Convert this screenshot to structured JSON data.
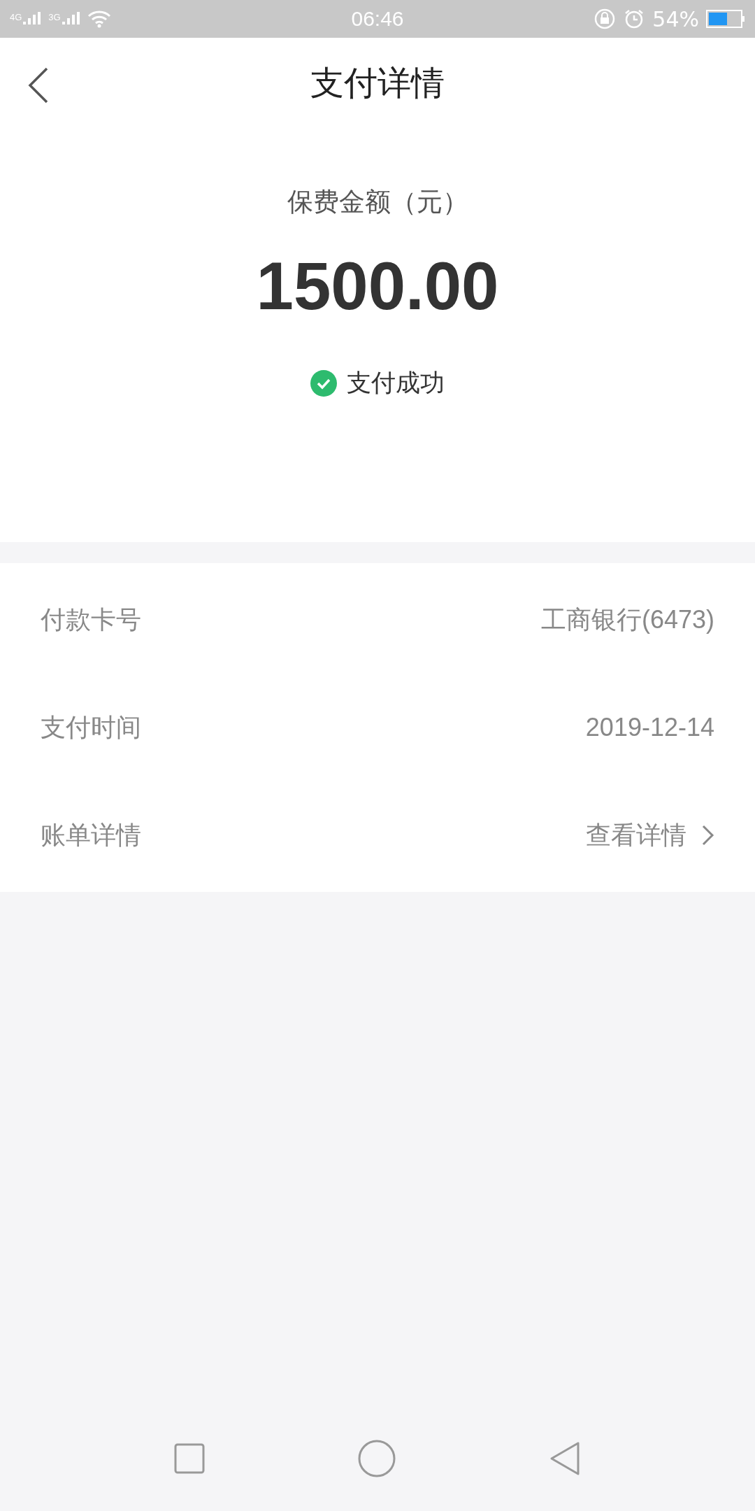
{
  "status_bar": {
    "network_1": "4G",
    "network_2": "3G",
    "time": "06:46",
    "battery": "54%"
  },
  "header": {
    "title": "支付详情"
  },
  "summary": {
    "label": "保费金额（元）",
    "amount": "1500.00",
    "status": "支付成功"
  },
  "details": [
    {
      "kind": "text",
      "label": "付款卡号",
      "value": "工商银行(6473)"
    },
    {
      "kind": "text",
      "label": "支付时间",
      "value": "2019-12-14"
    },
    {
      "kind": "link",
      "label": "账单详情",
      "value": "查看详情"
    }
  ]
}
